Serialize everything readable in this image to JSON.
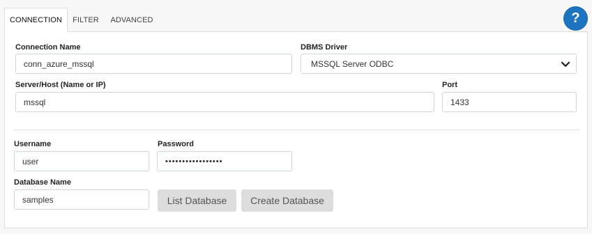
{
  "tabs": [
    {
      "label": "CONNECTION",
      "active": true
    },
    {
      "label": "FILTER",
      "active": false
    },
    {
      "label": "ADVANCED",
      "active": false
    }
  ],
  "help": {
    "icon": "question-icon",
    "glyph": "?",
    "color": "#1f74bf"
  },
  "fields": {
    "connection_name": {
      "label": "Connection Name",
      "value": "conn_azure_mssql"
    },
    "dbms_driver": {
      "label": "DBMS Driver",
      "value": "MSSQL Server ODBC"
    },
    "server_host": {
      "label": "Server/Host (Name or IP)",
      "value": "mssql"
    },
    "port": {
      "label": "Port",
      "value": "1433"
    },
    "username": {
      "label": "Username",
      "value": "user"
    },
    "password": {
      "label": "Password",
      "value": "•••••••••••••••••"
    },
    "database_name": {
      "label": "Database Name",
      "value": "samples"
    }
  },
  "buttons": {
    "list_database": "List Database",
    "create_database": "Create Database"
  }
}
